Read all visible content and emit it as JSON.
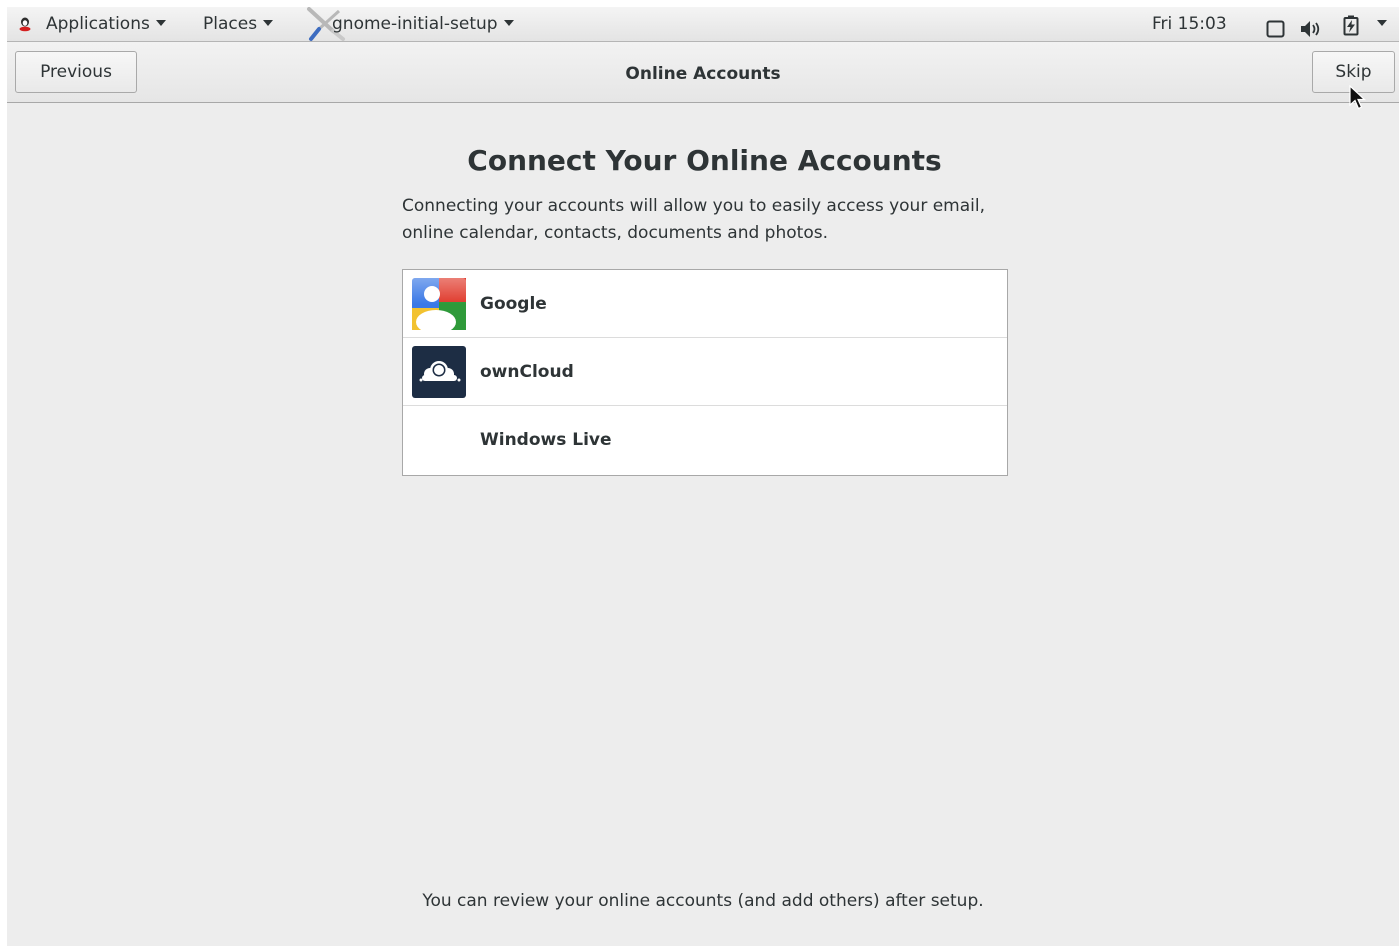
{
  "top_panel": {
    "applications_label": "Applications",
    "places_label": "Places",
    "window_label": "gnome-initial-setup",
    "clock": "Fri 15:03",
    "icons": [
      "applications-icon",
      "wrench-icon",
      "screen-icon",
      "volume-icon",
      "battery-icon",
      "system-menu-arrow-icon"
    ]
  },
  "header_bar": {
    "previous_label": "Previous",
    "title": "Online Accounts",
    "skip_label": "Skip"
  },
  "main": {
    "heading": "Connect Your Online Accounts",
    "description": "Connecting your accounts will allow you to easily access your email, online calendar, contacts, documents and photos.",
    "accounts": [
      {
        "label": "Google",
        "icon": "google-icon"
      },
      {
        "label": "ownCloud",
        "icon": "owncloud-icon"
      },
      {
        "label": "Windows Live",
        "icon": "none"
      }
    ],
    "footer_note": "You can review your online accounts (and add others) after setup."
  },
  "colors": {
    "background": "#ededed",
    "text": "#2e3436",
    "list_background": "#ffffff",
    "border": "#a8a8a8"
  }
}
